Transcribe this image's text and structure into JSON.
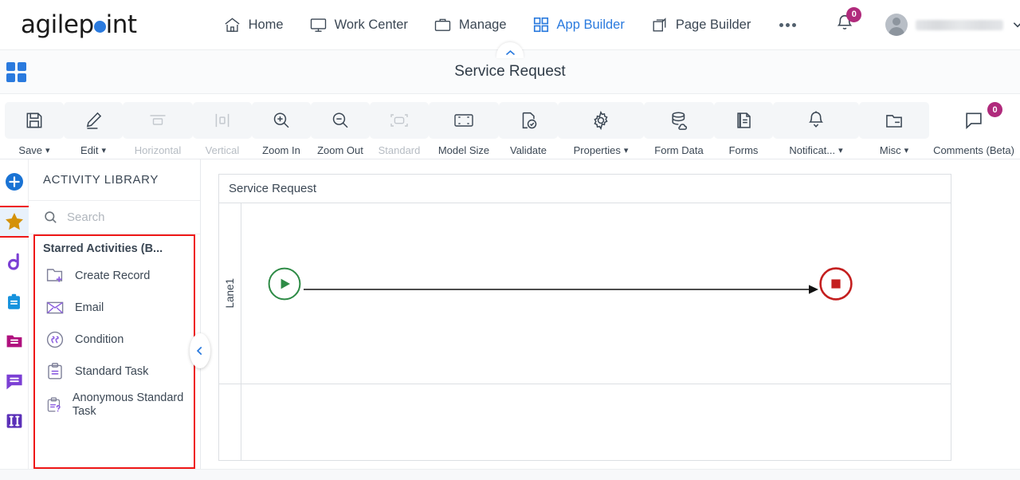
{
  "brand": {
    "name_part1": "agilep",
    "name_part2": "int",
    "accent": "#2a7ade"
  },
  "topnav": {
    "items": [
      {
        "label": "Home",
        "icon": "home-icon",
        "active": false
      },
      {
        "label": "Work Center",
        "icon": "monitor-icon",
        "active": false
      },
      {
        "label": "Manage",
        "icon": "briefcase-icon",
        "active": false
      },
      {
        "label": "App Builder",
        "icon": "grid-icon",
        "active": true
      },
      {
        "label": "Page Builder",
        "icon": "pages-icon",
        "active": false
      }
    ],
    "overflow_label": "...",
    "notifications": {
      "count": "0",
      "icon": "bell-icon",
      "badge_color": "#b02a7c"
    },
    "user": {
      "name": "",
      "icon": "avatar",
      "chevron": "chevron-down-icon"
    }
  },
  "titlebar": {
    "app_grid_icon": "app-grid-icon",
    "title": "Service Request",
    "collapse_icon": "chevron-up-icon"
  },
  "toolbar": {
    "buttons": [
      {
        "label": "Save",
        "icon": "save-icon",
        "caret": true,
        "disabled": false
      },
      {
        "label": "Edit",
        "icon": "pencil-icon",
        "caret": true,
        "disabled": false
      },
      {
        "label": "Horizontal",
        "icon": "horizontal-align-icon",
        "caret": false,
        "disabled": true
      },
      {
        "label": "Vertical",
        "icon": "vertical-align-icon",
        "caret": false,
        "disabled": true
      },
      {
        "label": "Zoom In",
        "icon": "zoom-in-icon",
        "caret": false,
        "disabled": false
      },
      {
        "label": "Zoom Out",
        "icon": "zoom-out-icon",
        "caret": false,
        "disabled": false
      },
      {
        "label": "Standard",
        "icon": "standard-size-icon",
        "caret": false,
        "disabled": true
      },
      {
        "label": "Model Size",
        "icon": "model-size-icon",
        "caret": false,
        "disabled": false
      },
      {
        "label": "Validate",
        "icon": "validate-icon",
        "caret": false,
        "disabled": false
      },
      {
        "label": "Properties",
        "icon": "gear-icon",
        "caret": true,
        "disabled": false
      },
      {
        "label": "Form Data",
        "icon": "database-icon",
        "caret": false,
        "disabled": false
      },
      {
        "label": "Forms",
        "icon": "forms-icon",
        "caret": false,
        "disabled": false
      },
      {
        "label": "Notificat...",
        "icon": "bell-icon",
        "caret": true,
        "disabled": false
      },
      {
        "label": "Misc",
        "icon": "folder-icon",
        "caret": true,
        "disabled": false
      },
      {
        "label": "Comments (Beta)",
        "icon": "comment-icon",
        "caret": false,
        "disabled": false,
        "badge": "0"
      }
    ]
  },
  "rail": {
    "items": [
      {
        "name": "add-activity",
        "icon": "plus-circle-icon",
        "color": "#1a73d4",
        "selected": false
      },
      {
        "name": "starred-activities",
        "icon": "star-icon",
        "color": "#d49108",
        "selected": true
      },
      {
        "name": "agilepoint-activities",
        "icon": "agilepoint-logo-icon",
        "color": "#7b3fd4",
        "selected": false
      },
      {
        "name": "task-activities",
        "icon": "clipboard-icon",
        "color": "#1692dd",
        "selected": false
      },
      {
        "name": "document-activities",
        "icon": "folder-icon",
        "color": "#b0117e",
        "selected": false
      },
      {
        "name": "message-activities",
        "icon": "chat-icon",
        "color": "#7b3fd4",
        "selected": false
      },
      {
        "name": "swimlane-activities",
        "icon": "columns-icon",
        "color": "#5b30b8",
        "selected": false
      }
    ]
  },
  "library": {
    "title": "ACTIVITY LIBRARY",
    "search": {
      "placeholder": "Search",
      "value": "",
      "icon": "search-icon"
    },
    "group_label": "Starred Activities (B...",
    "highlight_color": "#ef1717",
    "activities": [
      {
        "label": "Create Record",
        "icon": "create-record-icon"
      },
      {
        "label": "Email",
        "icon": "email-icon"
      },
      {
        "label": "Condition",
        "icon": "condition-icon"
      },
      {
        "label": "Standard Task",
        "icon": "standard-task-icon"
      },
      {
        "label": "Anonymous Standard Task",
        "icon": "anonymous-standard-task-icon"
      }
    ],
    "collapse_icon": "chevron-left-icon"
  },
  "canvas": {
    "pool_title": "Service Request",
    "lanes": [
      {
        "label": "Lane1"
      },
      {
        "label": ""
      }
    ],
    "nodes": [
      {
        "type": "start-event",
        "color": "#2e8b46"
      },
      {
        "type": "end-event",
        "color": "#c41f1f"
      }
    ],
    "connector": {
      "type": "sequence-flow"
    }
  }
}
